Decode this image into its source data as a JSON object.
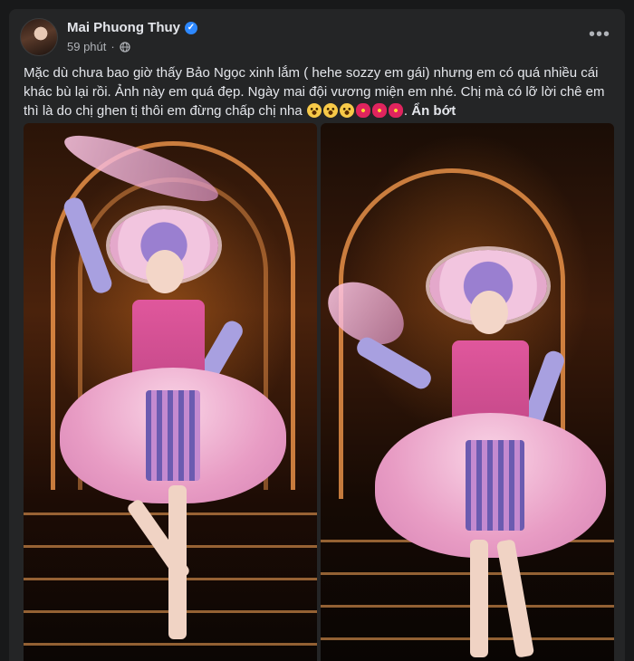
{
  "post": {
    "author": "Mai Phuong Thuy",
    "time": "59 phút",
    "separator": "·",
    "caption": "Mặc dù chưa bao giờ thấy Bảo Ngọc xinh lắm ( hehe sozzy em gái) nhưng em có quá nhiều cái khác bù lại rồi. Ảnh này em quá đẹp. Ngày mai đội vương miện em nhé. Chị mà có lỡ lời chê em thì là do chị ghen tị thôi em đừng chấp chị nha",
    "see_less": "Ẩn bớt",
    "emojis": [
      "shocked-face",
      "shocked-face",
      "shocked-face",
      "red-flower",
      "red-flower",
      "red-flower"
    ]
  },
  "icons": {
    "verified": "verified-badge-icon",
    "audience": "globe-icon",
    "more": "more-options-icon"
  },
  "colors": {
    "background": "#18191a",
    "card": "#242526",
    "text": "#e4e6eb",
    "secondary_text": "#b0b3b8",
    "verified_blue": "#2d88ff"
  }
}
